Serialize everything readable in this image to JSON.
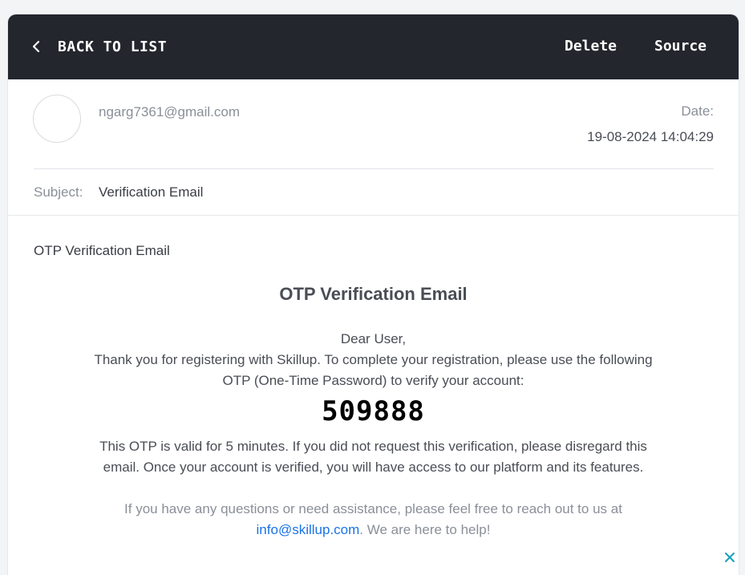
{
  "toolbar": {
    "back_label": "BACK TO LIST",
    "delete_label": "Delete",
    "source_label": "Source"
  },
  "email": {
    "sender": "ngarg7361@gmail.com",
    "date_label": "Date:",
    "date_value": "19-08-2024 14:04:29",
    "subject_label": "Subject:",
    "subject_value": "Verification Email",
    "preheader": "OTP Verification Email",
    "heading": "OTP Verification Email",
    "greeting": "Dear User,",
    "intro": "Thank you for registering with Skillup. To complete your registration, please use the following OTP (One-Time Password) to verify your account:",
    "otp": "509888",
    "validity": "This OTP is valid for 5 minutes. If you did not request this verification, please disregard this email. Once your account is verified, you will have access to our platform and its features.",
    "help_prefix": "If you have any questions or need assistance, please feel free to reach out to us at ",
    "help_link": "info@skillup.com",
    "help_suffix": ". We are here to help!"
  },
  "icons": {
    "back": "chevron-left-icon",
    "close": "close-icon"
  },
  "colors": {
    "topbar": "#23262d",
    "link": "#1a73e8",
    "close_icon": "#17a2b8"
  }
}
